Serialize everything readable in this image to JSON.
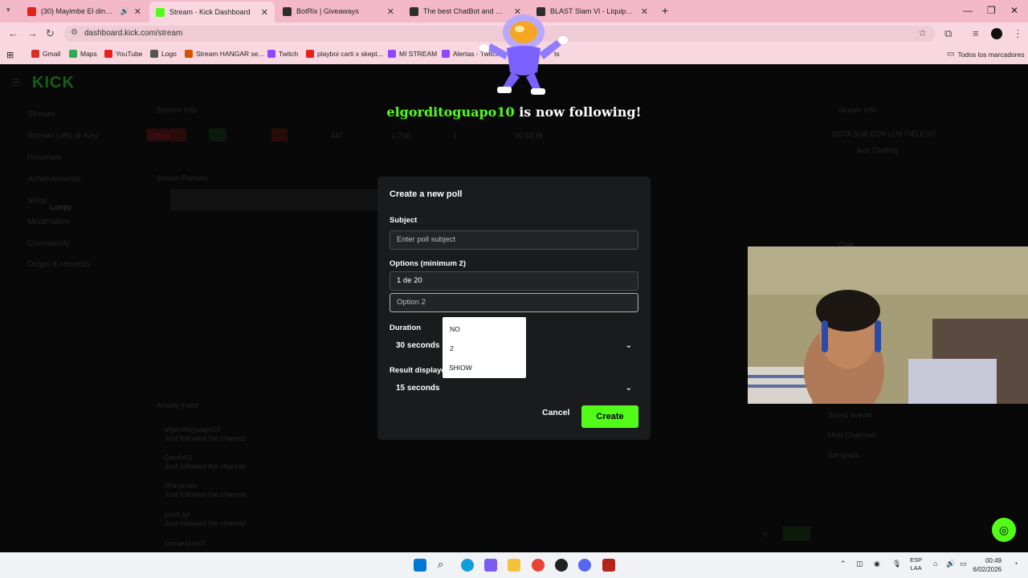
{
  "browser": {
    "tabs": [
      {
        "title": "(30) Mayimbe El dinero [let",
        "icon_color": "#e62117",
        "active": false
      },
      {
        "title": "Stream - Kick Dashboard",
        "icon_color": "#53fc18",
        "active": true
      },
      {
        "title": "BotRix | Giveaways",
        "icon_color": "#2d2d2d",
        "active": false
      },
      {
        "title": "The best ChatBot and Widgets",
        "icon_color": "#2d2d2d",
        "active": false
      },
      {
        "title": "BLAST Slam VI - Liquipedia Dot",
        "icon_color": "#2d2d2d",
        "active": false
      }
    ],
    "new_tab": "+",
    "window_controls": {
      "minimize": "—",
      "maximize": "❐",
      "close": "✕"
    },
    "url": "dashboard.kick.com/stream",
    "bookmarks": [
      {
        "label": "Gmail",
        "color": "#d93025"
      },
      {
        "label": "Maps",
        "color": "#34a853"
      },
      {
        "label": "YouTube",
        "color": "#e62117"
      },
      {
        "label": "Logo",
        "color": "#555555"
      },
      {
        "label": "Stream HANGAR se...",
        "color": "#d35400"
      },
      {
        "label": "Twitch",
        "color": "#9146ff"
      },
      {
        "label": "playboi carti x skept...",
        "color": "#e62117"
      },
      {
        "label": "MI STREAM",
        "color": "#9146ff"
      },
      {
        "label": "Alertas - Twitch",
        "color": "#9146ff"
      },
      {
        "label": "ts",
        "color": "#555555"
      }
    ],
    "all_bookmarks": "Todos los marcadores"
  },
  "dashboard": {
    "logo": "KICK",
    "sidebar": [
      "Stream",
      "Stream URL & Key",
      "Revenue",
      "Achievements",
      "Shop",
      "Moderation",
      "Community",
      "Drops & rewards"
    ],
    "panels": [
      "Session Info",
      "Stream Preview",
      "Activity Feed",
      "Stream Info",
      "Chat"
    ],
    "session_stats": [
      "Offline",
      "447",
      "1,736",
      "1",
      "00:33:35"
    ],
    "stream_title": "DOTA SUB CON LOS FIELES!!!",
    "category": "Just Chatting",
    "feed": [
      {
        "name": "elgorditoguapo10",
        "event": "Just followed the channel"
      },
      {
        "name": "Dardo01",
        "event": "Just followed the channel"
      },
      {
        "name": "rifundrosu",
        "event": "Just followed the channel"
      },
      {
        "name": "Lesh.tyl",
        "event": "Just followed the channel"
      },
      {
        "name": "condessoro1",
        "event": "Just followed the channel"
      }
    ],
    "menu": [
      "Saved events",
      "Host Chatroom",
      "Set goals"
    ],
    "viewer_count": "0"
  },
  "alert": {
    "name": "elgorditoguapo10",
    "text": "is now following!"
  },
  "modal": {
    "title": "Create a new poll",
    "subject_label": "Subject",
    "subject_placeholder": "Enter poll subject",
    "options_label": "Options (minimum 2)",
    "option1_value": "1 de 20",
    "option2_placeholder": "Option 2",
    "duration_label": "Duration",
    "duration_value": "30 seconds",
    "result_label": "Result displayed for",
    "result_value": "15 seconds",
    "cancel": "Cancel",
    "create": "Create"
  },
  "autocomplete": [
    "NO",
    "2",
    "SHIOW"
  ],
  "taskbar": {
    "language": "ESP",
    "layout": "LAA",
    "time": "00:49",
    "date": "6/02/2026"
  },
  "colors": {
    "kick_green": "#53fc18",
    "modal_bg": "#1a1b1d",
    "tabbar": "#f4b9c9"
  }
}
